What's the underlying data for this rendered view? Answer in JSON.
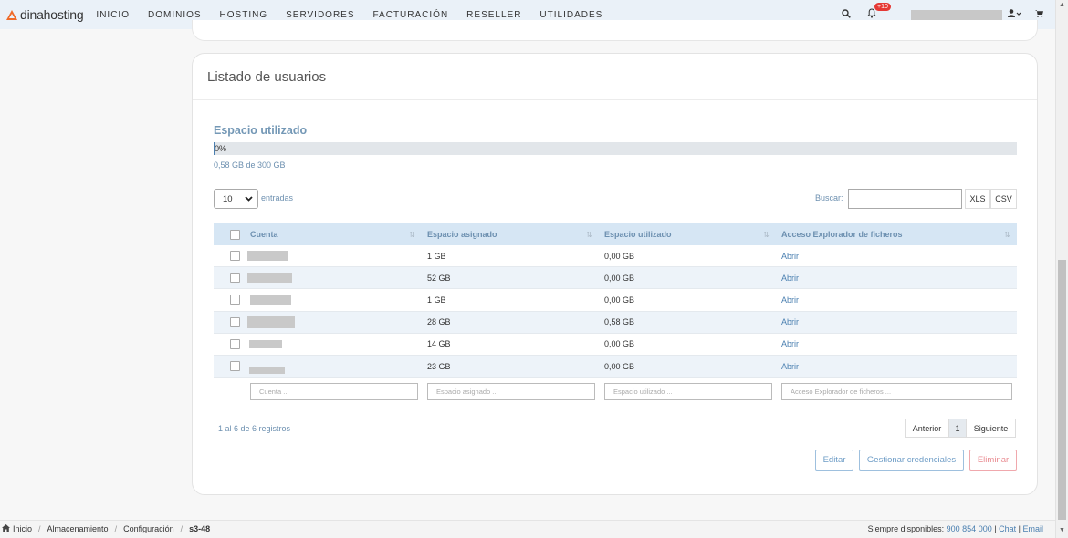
{
  "brand": {
    "name": "dinahosting",
    "accent": "#ef6b2a"
  },
  "nav": {
    "items": [
      "INICIO",
      "DOMINIOS",
      "HOSTING",
      "SERVIDORES",
      "FACTURACIÓN",
      "RESELLER",
      "UTILIDADES"
    ],
    "search_icon": "🔍",
    "notif_icon": "🔔",
    "notif_badge": "+10",
    "user_icon": "👤▾",
    "cart_icon": "🛒"
  },
  "card": {
    "title": "Listado de usuarios",
    "space_title": "Espacio utilizado",
    "progress_label": "0%",
    "progress_fraction": 0.0019,
    "space_sub": "0,58 GB de 300 GB"
  },
  "controls": {
    "length_value": "10",
    "length_label": "entradas",
    "search_label": "Buscar:",
    "xls": "XLS",
    "csv": "CSV"
  },
  "table": {
    "headers": [
      "Cuenta",
      "Espacio asignado",
      "Espacio utilizado",
      "Acceso Explorador de ficheros"
    ],
    "rows": [
      {
        "assigned": "1 GB",
        "used": "0,00 GB",
        "action": "Abrir"
      },
      {
        "assigned": "52 GB",
        "used": "0,00 GB",
        "action": "Abrir"
      },
      {
        "assigned": "1 GB",
        "used": "0,00 GB",
        "action": "Abrir"
      },
      {
        "assigned": "28 GB",
        "used": "0,58 GB",
        "action": "Abrir"
      },
      {
        "assigned": "14 GB",
        "used": "0,00 GB",
        "action": "Abrir"
      },
      {
        "assigned": "23 GB",
        "used": "0,00 GB",
        "action": "Abrir"
      }
    ],
    "filters": [
      "Cuenta ...",
      "Espacio asignado ...",
      "Espacio utilizado ...",
      "Acceso Explorador de ficheros ..."
    ]
  },
  "footer_info": "1 al 6 de 6 registros",
  "pager": {
    "prev": "Anterior",
    "current": "1",
    "next": "Siguiente"
  },
  "actions": {
    "edit": "Editar",
    "credentials": "Gestionar credenciales",
    "delete": "Eliminar"
  },
  "breadcrumb": {
    "home_icon": "🏠",
    "items": [
      "Inicio",
      "Almacenamiento",
      "Configuración"
    ],
    "current": "s3-48"
  },
  "contact": {
    "label": "Siempre disponibles:",
    "phone": "900 854 000",
    "chat": "Chat",
    "email": "Email",
    "sep": "|"
  }
}
